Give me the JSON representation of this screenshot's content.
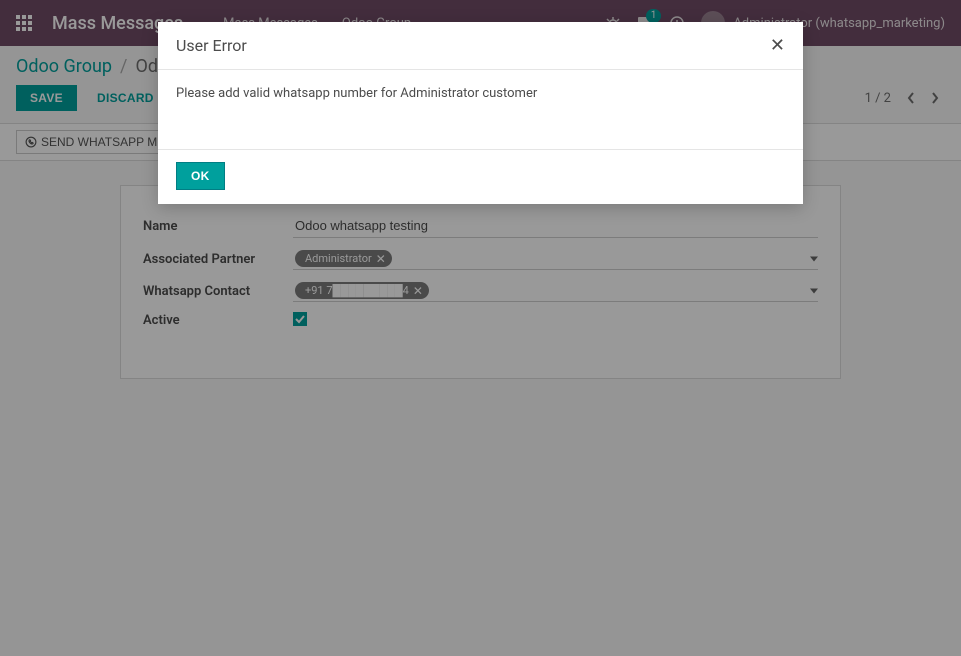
{
  "topbar": {
    "app_title": "Mass Messages",
    "menu": [
      "Mass Messages",
      "Odoo Group"
    ],
    "chat_badge": "1",
    "user_name": "Administrator (whatsapp_marketing)"
  },
  "breadcrumb": {
    "link": "Odoo Group",
    "separator": "/",
    "current": "Odoo whatsapp testing"
  },
  "actions": {
    "save": "SAVE",
    "discard": "DISCARD"
  },
  "pager": {
    "text": "1 / 2"
  },
  "statusbar": {
    "send_label": "SEND WHATSAPP MESSAGE"
  },
  "form": {
    "name_label": "Name",
    "name_value": "Odoo whatsapp testing",
    "partner_label": "Associated Partner",
    "partner_tag": "Administrator",
    "contact_label": "Whatsapp Contact",
    "contact_tag": "+91 7█████████4",
    "active_label": "Active",
    "active_checked": true
  },
  "modal": {
    "title": "User Error",
    "body": "Please add valid whatsapp number for Administrator customer",
    "ok": "OK"
  }
}
